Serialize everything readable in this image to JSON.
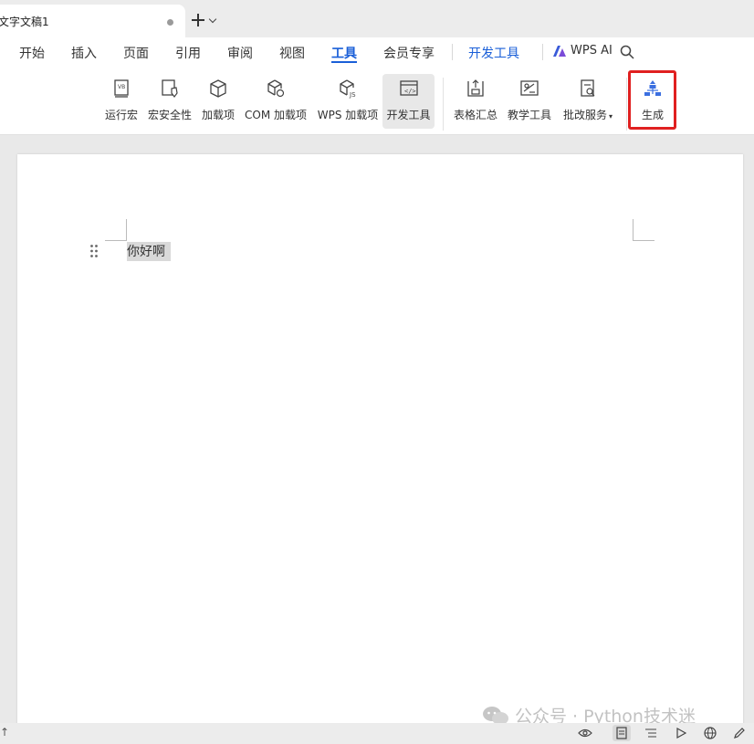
{
  "tabbar": {
    "doc_tab_title": "文字文稿1"
  },
  "menu": {
    "items": [
      "开始",
      "插入",
      "页面",
      "引用",
      "审阅",
      "视图",
      "工具",
      "会员专享",
      "开发工具"
    ],
    "active": "工具",
    "wps_ai": "WPS AI"
  },
  "ribbon": {
    "buttons": [
      {
        "label": "运行宏",
        "icon": "run-macro-icon"
      },
      {
        "label": "宏安全性",
        "icon": "macro-security-icon"
      },
      {
        "label": "加载项",
        "icon": "addin-cube-icon"
      },
      {
        "label": "COM 加载项",
        "icon": "com-addin-icon"
      },
      {
        "label": "WPS 加载项",
        "icon": "wps-addin-icon"
      },
      {
        "label": "开发工具",
        "icon": "dev-tools-icon"
      },
      {
        "label": "表格汇总",
        "icon": "table-summary-icon"
      },
      {
        "label": "教学工具",
        "icon": "teaching-tools-icon"
      },
      {
        "label": "批改服务",
        "icon": "grading-service-icon"
      },
      {
        "label": "生成",
        "icon": "generate-icon"
      }
    ],
    "selected": "开发工具",
    "highlighted": "生成",
    "highlight_color": "#e02020"
  },
  "document": {
    "text": "你好啊"
  },
  "watermark": {
    "text": "公众号 · Python技术迷"
  },
  "colors": {
    "accent": "#1a5fd8"
  }
}
